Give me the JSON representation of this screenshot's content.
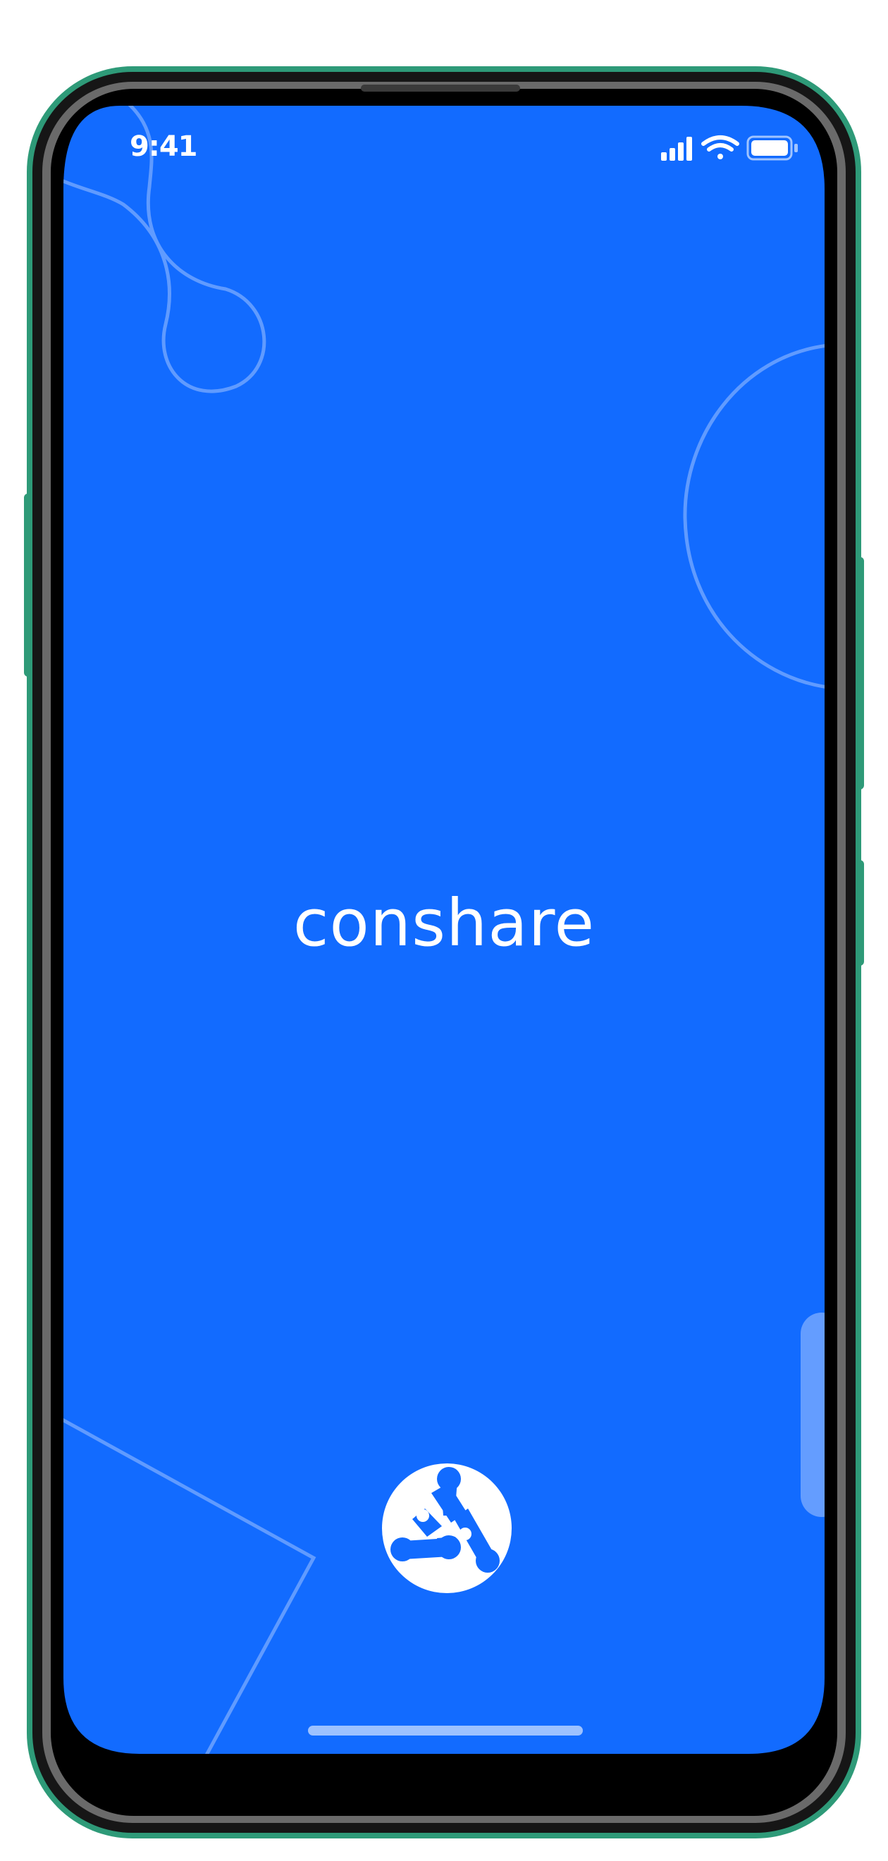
{
  "status_bar": {
    "time": "9:41",
    "icons": [
      "cellular-signal-icon",
      "wifi-icon",
      "battery-icon"
    ]
  },
  "splash": {
    "app_name": "conshare",
    "logo": "conshare-logo-icon"
  },
  "colors": {
    "background": "#126BFF",
    "text": "#FFFFFF",
    "decoration": "#6EA3FF",
    "home_indicator": "#9DC2FF",
    "device_frame": "#0B0B0B",
    "device_rim": "#2E9A78"
  }
}
